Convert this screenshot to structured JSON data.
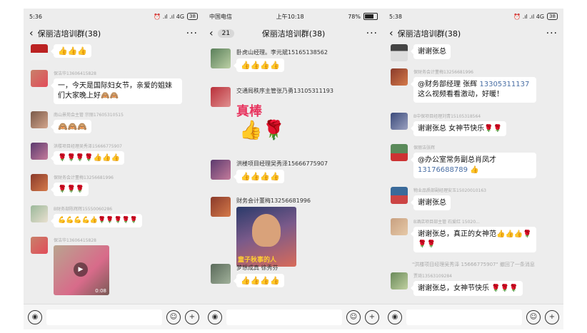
{
  "panel1": {
    "status": {
      "time": "5:36",
      "icons": "⏰ .ıl .ıl 4G",
      "battery": "38"
    },
    "title": "保丽洁培训群(38)",
    "messages": [
      {
        "sender": "",
        "text": "👍👍👍"
      },
      {
        "sender": "保洁华13606415828",
        "text": "一，今天是国际妇女节，亲爱的姐妹们大家晚上好🙈🙈"
      },
      {
        "sender": "南山景苑会主管 宗丽17605310515",
        "text": "🙈🙈🙈"
      },
      {
        "sender": "洪楼项目经理吴秀泽15666775907",
        "text": "🌹🌹🌹🌹👍👍👍"
      },
      {
        "sender": "保财务会计董梅13256681996",
        "text": "🌹🌹🌹"
      },
      {
        "sender": "B财务部陈辉辉15550060286",
        "text": "💪💪💪💪👍🌹🌹🌹🌹🌹"
      },
      {
        "sender": "保洁华13606415828",
        "text": ""
      }
    ],
    "video_time": "0:08"
  },
  "panel2": {
    "status": {
      "carrier": "中国电信",
      "time": "上午10:18",
      "battery": "78%"
    },
    "back_count": "21",
    "title": "保丽洁培训群(38)",
    "messages": [
      {
        "sender": "卧虎山经理。李元斌15165138562",
        "text": "👍👍👍👍"
      },
      {
        "sender": "交通局秩序主管张乃勇13105311193",
        "text": "真棒"
      },
      {
        "sender": "洪楼项目经理吴秀泽15666775907",
        "text": "👍👍👍👍"
      },
      {
        "sender": "财务会计董梅13256681996",
        "text": ""
      },
      {
        "sender": "梦想成真 徐秀芬",
        "text": "👍👍👍👍"
      }
    ],
    "sticker_caption": "童子秋事的人"
  },
  "panel3": {
    "status": {
      "time": "5:38",
      "icons": "⏰ .ıl .ıl 4G",
      "battery": "38"
    },
    "title": "保丽洁培训群(38)",
    "messages": [
      {
        "sender": "",
        "text": "谢谢张总"
      },
      {
        "sender": "保财务会计董梅13256681996",
        "text": "@财务部经理  张辉 13305311137 这么视频看看激动，好暖！",
        "mention": "13305311137"
      },
      {
        "sender": "B中保项目经理刘青15105318564",
        "text": "谢谢张总 女神节快乐🌹🌹"
      },
      {
        "sender": "保丽洁张辉",
        "text": "@办公室常务副总肖凤才 13176688789 👍",
        "mention": "13176688789"
      },
      {
        "sender": "物业品质部副经理安玉15020010163",
        "text": "谢谢张总"
      },
      {
        "sender": "B酒店项目部主管 石爱红 15020...",
        "text": "谢谢张总，真正的女神范👍👍👍🌹🌹🌹"
      },
      {
        "sender": "贾琦13563109284",
        "text": "谢谢张总，女神节快乐 🌹🌹🌹"
      }
    ],
    "system_note": "\"洪楼项目经理吴秀泽 15666775907\" 撤回了一条消息"
  },
  "input": {
    "voice_icon": "voice-icon",
    "emoji_icon": "emoji-icon",
    "plus_icon": "plus-icon"
  }
}
